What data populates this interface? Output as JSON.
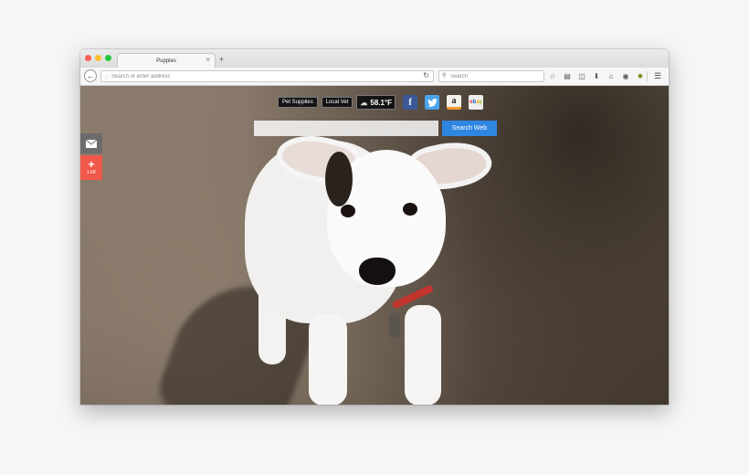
{
  "browser": {
    "tab_title": "Puppies",
    "tab_close": "×",
    "new_tab": "+",
    "address_placeholder": "Search or enter address",
    "search_placeholder": "Search",
    "toolbar_icons": [
      "star-icon",
      "clipboard-icon",
      "pocket-icon",
      "download-icon",
      "home-icon",
      "chat-icon",
      "addon-icon"
    ],
    "menu_icon": "hamburger-menu-icon"
  },
  "page": {
    "links": [
      {
        "label": "Pet Supplies"
      },
      {
        "label": "Local Vet"
      }
    ],
    "weather": {
      "temperature": "58.1°F",
      "icon": "cloud-icon"
    },
    "apps": [
      {
        "name": "facebook-icon",
        "glyph": "f",
        "color": "#3b5998"
      },
      {
        "name": "twitter-icon",
        "glyph": "🐦",
        "color": "#4aa4ec"
      },
      {
        "name": "amazon-icon",
        "glyph": "a",
        "color": "#f09b30"
      },
      {
        "name": "ebay-icon",
        "glyph": "ebay",
        "color": "#e53238"
      }
    ],
    "search": {
      "input_value": "",
      "button_label": "Search Web",
      "button_color": "#2f86e0"
    },
    "side": {
      "mail_icon": "envelope-icon",
      "share_icon": "plus-icon",
      "share_count": "1.6K",
      "share_color": "#f0584b"
    }
  },
  "colors": {
    "close": "#fc5f57",
    "minimize": "#fdbd2e",
    "maximize": "#28c840"
  }
}
